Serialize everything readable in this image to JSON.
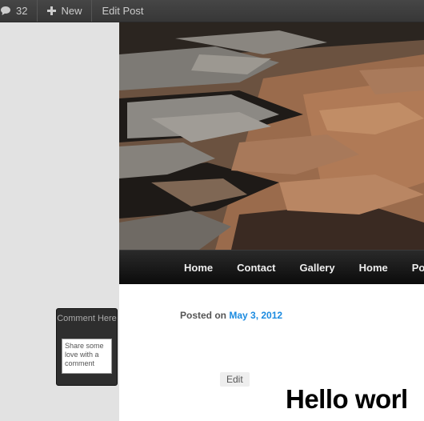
{
  "adminbar": {
    "comments_count": "32",
    "new_label": "New",
    "edit_post_label": "Edit Post"
  },
  "nav": {
    "items": [
      "Home",
      "Contact",
      "Gallery",
      "Home",
      "Po"
    ]
  },
  "post": {
    "posted_on_label": "Posted on",
    "date": "May 3, 2012",
    "edit_label": "Edit",
    "title": "Hello worl"
  },
  "comment_widget": {
    "title": "Comment Here",
    "placeholder": "Share some love with a comment"
  },
  "colors": {
    "adminbar": "#3c3c3c",
    "link": "#1b8be0",
    "nav": "#111111"
  }
}
